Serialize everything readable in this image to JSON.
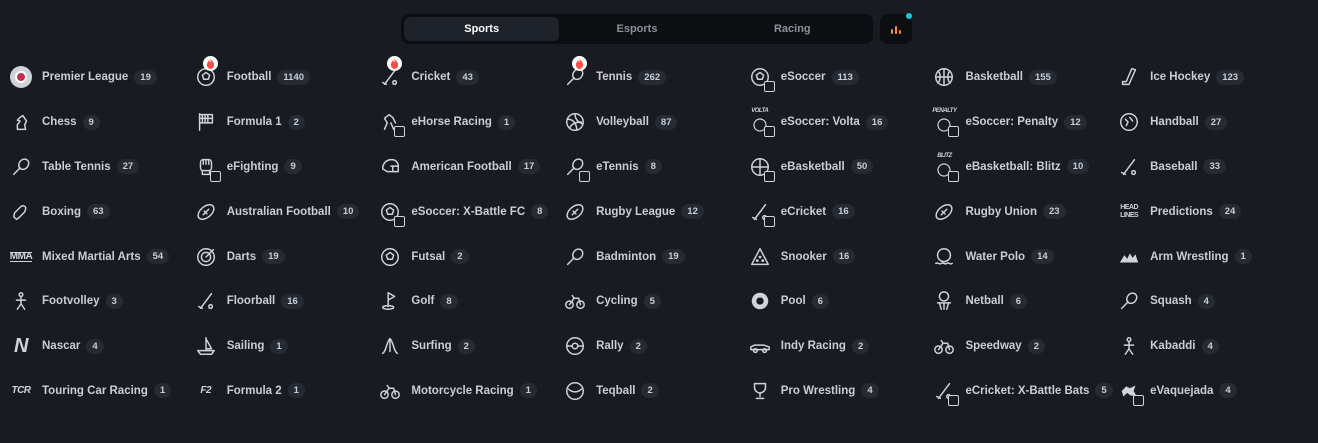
{
  "tabs": [
    {
      "label": "Sports",
      "active": true
    },
    {
      "label": "Esports",
      "active": false
    },
    {
      "label": "Racing",
      "active": false
    }
  ],
  "colors": {
    "accent_hot": "#ff4b4b",
    "stats_bars": "#ff8a3d",
    "notification_dot": "#23c4dd"
  },
  "sports": [
    {
      "label": "Premier League",
      "count": "19",
      "icon": "premier-league-icon"
    },
    {
      "label": "Football",
      "count": "1140",
      "icon": "football-icon",
      "hot": true
    },
    {
      "label": "Cricket",
      "count": "43",
      "icon": "cricket-icon",
      "hot": true
    },
    {
      "label": "Tennis",
      "count": "262",
      "icon": "tennis-icon",
      "hot": true
    },
    {
      "label": "eSoccer",
      "count": "113",
      "icon": "esoccer-icon"
    },
    {
      "label": "Basketball",
      "count": "155",
      "icon": "basketball-icon"
    },
    {
      "label": "Ice Hockey",
      "count": "123",
      "icon": "ice-hockey-icon"
    },
    {
      "label": "Chess",
      "count": "9",
      "icon": "chess-icon"
    },
    {
      "label": "Formula 1",
      "count": "2",
      "icon": "formula-1-icon"
    },
    {
      "label": "eHorse Racing",
      "count": "1",
      "icon": "ehorse-racing-icon"
    },
    {
      "label": "Volleyball",
      "count": "87",
      "icon": "volleyball-icon"
    },
    {
      "label": "eSoccer: Volta",
      "count": "16",
      "icon": "esoccer-volta-icon",
      "icon_text": "VOLTA"
    },
    {
      "label": "eSoccer: Penalty",
      "count": "12",
      "icon": "esoccer-penalty-icon",
      "icon_text": "PENALTY"
    },
    {
      "label": "Handball",
      "count": "27",
      "icon": "handball-icon"
    },
    {
      "label": "Table Tennis",
      "count": "27",
      "icon": "table-tennis-icon"
    },
    {
      "label": "eFighting",
      "count": "9",
      "icon": "efighting-icon"
    },
    {
      "label": "American Football",
      "count": "17",
      "icon": "american-football-icon"
    },
    {
      "label": "eTennis",
      "count": "8",
      "icon": "etennis-icon"
    },
    {
      "label": "eBasketball",
      "count": "50",
      "icon": "ebasketball-icon"
    },
    {
      "label": "eBasketball: Blitz",
      "count": "10",
      "icon": "ebasketball-blitz-icon",
      "icon_text": "BLITZ"
    },
    {
      "label": "Baseball",
      "count": "33",
      "icon": "baseball-icon"
    },
    {
      "label": "Boxing",
      "count": "63",
      "icon": "boxing-icon"
    },
    {
      "label": "Australian Football",
      "count": "10",
      "icon": "australian-football-icon"
    },
    {
      "label": "eSoccer: X-Battle FC",
      "count": "8",
      "icon": "esoccer-xbattle-icon"
    },
    {
      "label": "Rugby League",
      "count": "12",
      "icon": "rugby-league-icon"
    },
    {
      "label": "eCricket",
      "count": "16",
      "icon": "ecricket-icon"
    },
    {
      "label": "Rugby Union",
      "count": "23",
      "icon": "rugby-union-icon"
    },
    {
      "label": "Predictions",
      "count": "24",
      "icon": "predictions-icon",
      "icon_text": "HEAD LINES"
    },
    {
      "label": "Mixed Martial Arts",
      "count": "54",
      "icon": "mma-icon",
      "icon_text": "MMA"
    },
    {
      "label": "Darts",
      "count": "19",
      "icon": "darts-icon"
    },
    {
      "label": "Futsal",
      "count": "2",
      "icon": "futsal-icon"
    },
    {
      "label": "Badminton",
      "count": "19",
      "icon": "badminton-icon"
    },
    {
      "label": "Snooker",
      "count": "16",
      "icon": "snooker-icon"
    },
    {
      "label": "Water Polo",
      "count": "14",
      "icon": "water-polo-icon"
    },
    {
      "label": "Arm Wrestling",
      "count": "1",
      "icon": "arm-wrestling-icon"
    },
    {
      "label": "Footvolley",
      "count": "3",
      "icon": "footvolley-icon"
    },
    {
      "label": "Floorball",
      "count": "16",
      "icon": "floorball-icon"
    },
    {
      "label": "Golf",
      "count": "8",
      "icon": "golf-icon"
    },
    {
      "label": "Cycling",
      "count": "5",
      "icon": "cycling-icon"
    },
    {
      "label": "Pool",
      "count": "6",
      "icon": "pool-icon"
    },
    {
      "label": "Netball",
      "count": "6",
      "icon": "netball-icon"
    },
    {
      "label": "Squash",
      "count": "4",
      "icon": "squash-icon"
    },
    {
      "label": "Nascar",
      "count": "4",
      "icon": "nascar-icon",
      "icon_text": "N"
    },
    {
      "label": "Sailing",
      "count": "1",
      "icon": "sailing-icon"
    },
    {
      "label": "Surfing",
      "count": "2",
      "icon": "surfing-icon"
    },
    {
      "label": "Rally",
      "count": "2",
      "icon": "rally-icon"
    },
    {
      "label": "Indy Racing",
      "count": "2",
      "icon": "indy-racing-icon"
    },
    {
      "label": "Speedway",
      "count": "2",
      "icon": "speedway-icon"
    },
    {
      "label": "Kabaddi",
      "count": "4",
      "icon": "kabaddi-icon"
    },
    {
      "label": "Touring Car Racing",
      "count": "1",
      "icon": "touring-car-racing-icon",
      "icon_text": "TCR"
    },
    {
      "label": "Formula 2",
      "count": "1",
      "icon": "formula-2-icon",
      "icon_text": "F2"
    },
    {
      "label": "Motorcycle Racing",
      "count": "1",
      "icon": "motorcycle-racing-icon"
    },
    {
      "label": "Teqball",
      "count": "2",
      "icon": "teqball-icon"
    },
    {
      "label": "Pro Wrestling",
      "count": "4",
      "icon": "pro-wrestling-icon"
    },
    {
      "label": "eCricket: X-Battle Bats",
      "count": "5",
      "icon": "ecricket-xbattle-icon"
    },
    {
      "label": "eVaquejada",
      "count": "4",
      "icon": "evaquejada-icon"
    }
  ]
}
